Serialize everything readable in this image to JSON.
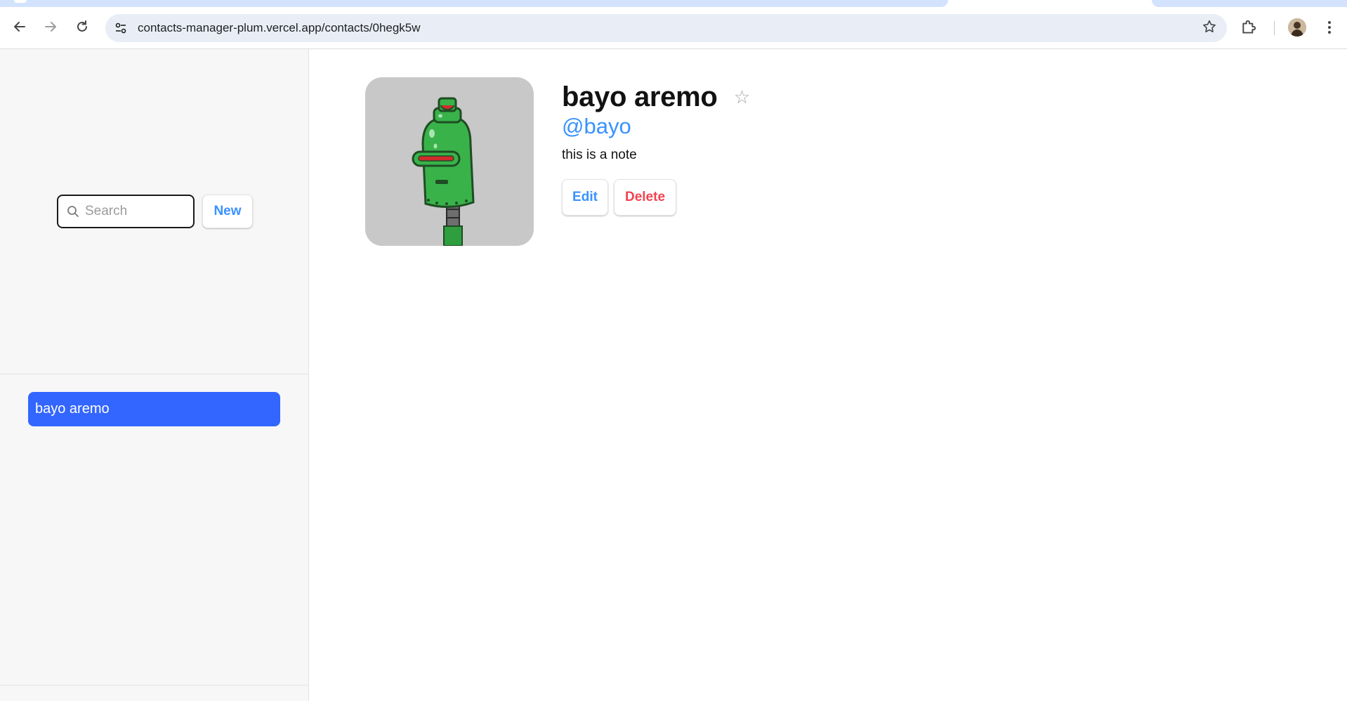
{
  "browser": {
    "url": "contacts-manager-plum.vercel.app/contacts/0hegk5w",
    "icons": {
      "back": "arrow-left-icon",
      "forward": "arrow-right-icon",
      "reload": "reload-icon",
      "site_info": "tune-icon",
      "bookmark": "star-outline-icon",
      "extensions": "puzzle-icon",
      "profile": "avatar",
      "menu": "kebab-menu-icon"
    }
  },
  "sidebar": {
    "search": {
      "placeholder": "Search",
      "value": ""
    },
    "new_label": "New",
    "contacts": [
      {
        "name": "bayo aremo",
        "active": true
      }
    ]
  },
  "contact": {
    "name": "bayo aremo",
    "favorite_glyph": "☆",
    "handle": "@bayo",
    "notes": "this is a note",
    "edit_label": "Edit",
    "delete_label": "Delete"
  },
  "colors": {
    "accent": "#3992ff",
    "active_item": "#3366ff",
    "danger": "#f44250",
    "sidebar_bg": "#f7f7f7"
  }
}
